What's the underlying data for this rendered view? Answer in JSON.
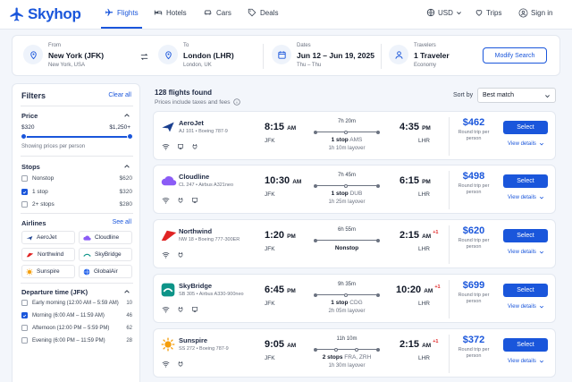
{
  "brand": {
    "name": "Skyhop",
    "color": "#1a56db"
  },
  "nav": {
    "tabs": [
      {
        "label": "Flights",
        "icon": "plane-icon",
        "active": true
      },
      {
        "label": "Hotels",
        "icon": "bed-icon"
      },
      {
        "label": "Cars",
        "icon": "car-icon"
      },
      {
        "label": "Deals",
        "icon": "tag-icon"
      }
    ],
    "currency": "USD",
    "trips": "Trips",
    "signin": "Sign in"
  },
  "search": {
    "from": {
      "label": "From",
      "value": "New York (JFK)",
      "sub": "New York, USA"
    },
    "to": {
      "label": "To",
      "value": "London (LHR)",
      "sub": "London, UK"
    },
    "dates": {
      "label": "Dates",
      "value": "Jun 12 – Jun 19, 2025",
      "sub": "Thu – Thu"
    },
    "travelers": {
      "label": "Travelers",
      "value": "1 Traveler",
      "sub": "Economy"
    },
    "modify_label": "Modify Search"
  },
  "filters": {
    "title": "Filters",
    "clear": "Clear all",
    "price": {
      "title": "Price",
      "min": "$320",
      "max": "$1,250+",
      "note": "Showing prices per person"
    },
    "stops": {
      "title": "Stops",
      "items": [
        {
          "label": "Nonstop",
          "value": "$620",
          "checked": false
        },
        {
          "label": "1 stop",
          "value": "$320",
          "checked": true
        },
        {
          "label": "2+ stops",
          "value": "$280",
          "checked": false
        }
      ]
    },
    "airlines": {
      "title": "Airlines",
      "see_all": "See all",
      "items": [
        {
          "name": "AeroJet"
        },
        {
          "name": "Cloudline"
        },
        {
          "name": "Northwind"
        },
        {
          "name": "SkyBridge"
        },
        {
          "name": "Sunspire"
        },
        {
          "name": "GlobalAir"
        }
      ]
    },
    "departure": {
      "title": "Departure time (JFK)",
      "items": [
        {
          "label": "Early morning (12:00 AM – 5:59 AM)",
          "value": "10",
          "checked": false
        },
        {
          "label": "Morning (6:00 AM – 11:59 AM)",
          "value": "46",
          "checked": true
        },
        {
          "label": "Afternoon (12:00 PM – 5:59 PM)",
          "value": "62",
          "checked": false
        },
        {
          "label": "Evening (6:00 PM – 11:59 PM)",
          "value": "28",
          "checked": false
        }
      ]
    }
  },
  "results": {
    "count": "128 flights found",
    "note": "Prices include taxes and fees",
    "sort_label": "Sort by",
    "sort_value": "Best match",
    "select_label": "Select",
    "details_label": "View details",
    "price_type": "Round trip per person",
    "flights": [
      {
        "airline": "AeroJet",
        "code": "AJ 101 • Boeing 787-9",
        "dep": "8:15",
        "dep_ampm": "AM",
        "dep_ap": "JFK",
        "arr": "4:35",
        "arr_ampm": "PM",
        "arr_ap": "LHR",
        "plus": "",
        "duration": "7h 20m",
        "stops": "1 stop",
        "via": "AMS",
        "layover": "1h 10m layover",
        "price": "$462",
        "logo": "aerojet-logo"
      },
      {
        "airline": "Cloudline",
        "code": "CL 247 • Airbus A321neo",
        "dep": "10:30",
        "dep_ampm": "AM",
        "dep_ap": "JFK",
        "arr": "6:15",
        "arr_ampm": "PM",
        "arr_ap": "LHR",
        "plus": "",
        "duration": "7h 45m",
        "stops": "1 stop",
        "via": "DUB",
        "layover": "1h 25m layover",
        "price": "$498",
        "logo": "cloudline-logo"
      },
      {
        "airline": "Northwind",
        "code": "NW 18 • Boeing 777-300ER",
        "dep": "1:20",
        "dep_ampm": "PM",
        "dep_ap": "JFK",
        "arr": "2:15",
        "arr_ampm": "AM",
        "arr_ap": "LHR",
        "plus": "+1",
        "duration": "6h 55m",
        "stops": "Nonstop",
        "via": "",
        "layover": "",
        "price": "$620",
        "logo": "northwind-logo"
      },
      {
        "airline": "SkyBridge",
        "code": "SB 305 • Airbus A330-900neo",
        "dep": "6:45",
        "dep_ampm": "PM",
        "dep_ap": "JFK",
        "arr": "10:20",
        "arr_ampm": "AM",
        "arr_ap": "LHR",
        "plus": "+1",
        "duration": "9h 35m",
        "stops": "1 stop",
        "via": "CDG",
        "layover": "2h 05m layover",
        "price": "$699",
        "logo": "skybridge-logo"
      },
      {
        "airline": "Sunspire",
        "code": "SS 272 • Boeing 787-9",
        "dep": "9:05",
        "dep_ampm": "AM",
        "dep_ap": "JFK",
        "arr": "2:15",
        "arr_ampm": "AM",
        "arr_ap": "LHR",
        "plus": "+1",
        "duration": "11h 10m",
        "stops": "2 stops",
        "via": "FRA, ZRH",
        "layover": "1h 30m layover",
        "price": "$372",
        "logo": "sunspire-logo"
      }
    ]
  }
}
